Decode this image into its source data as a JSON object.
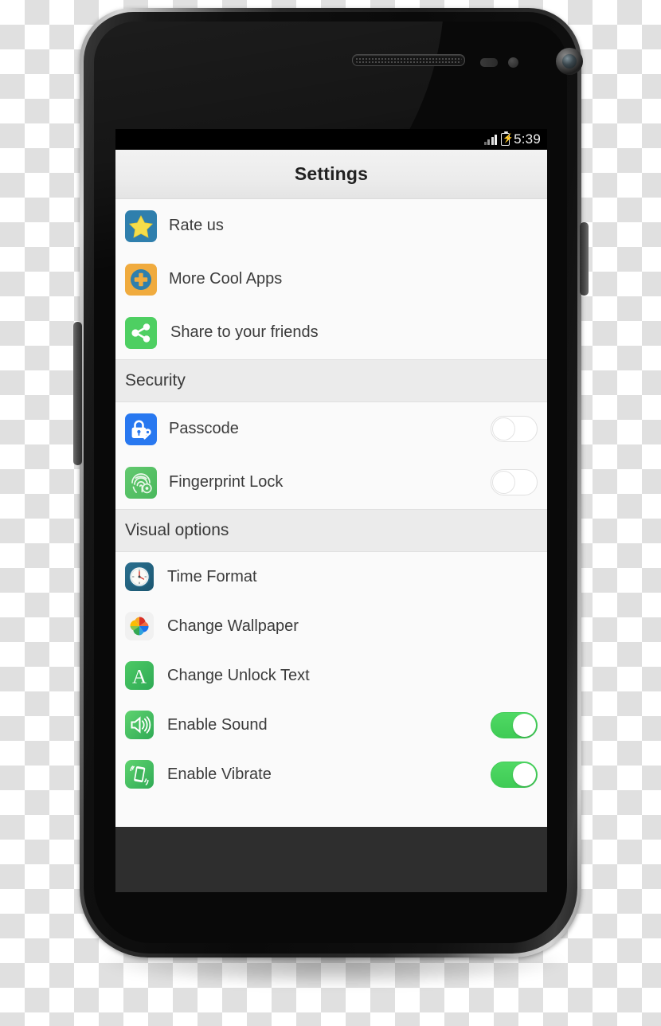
{
  "status_bar": {
    "signal_icon": "signal-bars-icon",
    "battery_icon": "battery-charging-icon",
    "time": "5:39"
  },
  "app_bar": {
    "title": "Settings"
  },
  "colors": {
    "accent_green": "#4fd964",
    "toggle_on": "#3fcb55",
    "toggle_off_border": "#e0e0e0",
    "section_header_bg": "#ebebeb",
    "list_bg": "#fafafa",
    "app_bar_bg": "#ececec",
    "text_primary": "#3b3b3b",
    "title_text": "#212121"
  },
  "sections": [
    {
      "id": "general",
      "header": null,
      "rows": [
        {
          "id": "rate-us",
          "label": "Rate us",
          "icon": "star-icon",
          "control": "none"
        },
        {
          "id": "more-apps",
          "label": "More Cool Apps",
          "icon": "plus-circle-icon",
          "control": "none"
        },
        {
          "id": "share",
          "label": "Share to your friends",
          "icon": "share-icon",
          "control": "none"
        }
      ]
    },
    {
      "id": "security",
      "header": "Security",
      "rows": [
        {
          "id": "passcode",
          "label": "Passcode",
          "icon": "lock-key-icon",
          "control": "toggle",
          "state": "off"
        },
        {
          "id": "fingerprint-lock",
          "label": "Fingerprint Lock",
          "icon": "fingerprint-icon",
          "control": "toggle",
          "state": "off"
        }
      ]
    },
    {
      "id": "visual-options",
      "header": "Visual options",
      "rows": [
        {
          "id": "time-format",
          "label": "Time Format",
          "icon": "clock-icon",
          "control": "none"
        },
        {
          "id": "change-wallpaper",
          "label": "Change Wallpaper",
          "icon": "pinwheel-icon",
          "control": "none"
        },
        {
          "id": "change-unlock-text",
          "label": "Change Unlock Text",
          "icon": "letter-a-icon",
          "control": "none"
        },
        {
          "id": "enable-sound",
          "label": "Enable Sound",
          "icon": "speaker-icon",
          "control": "toggle",
          "state": "on"
        },
        {
          "id": "enable-vibrate",
          "label": "Enable Vibrate",
          "icon": "vibrate-icon",
          "control": "toggle",
          "state": "on"
        }
      ]
    }
  ]
}
